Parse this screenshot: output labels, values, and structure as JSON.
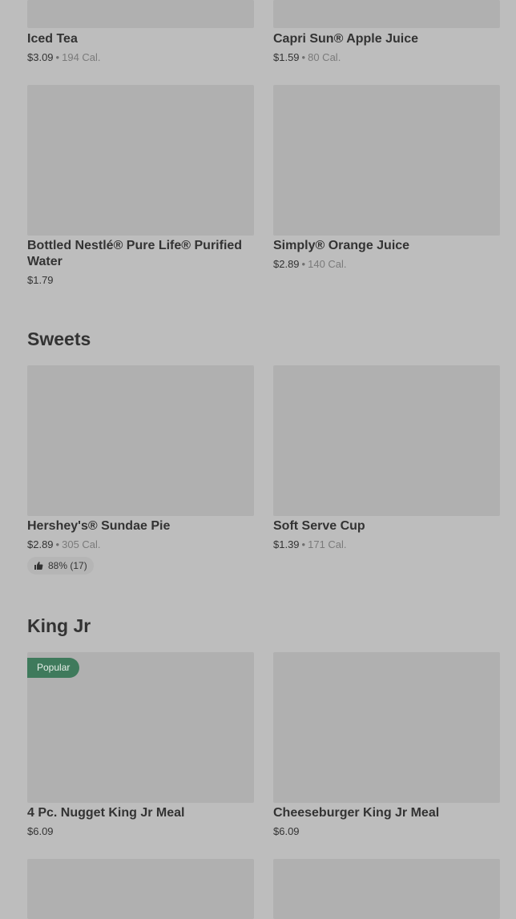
{
  "sections": [
    {
      "title": "",
      "items": [
        {
          "name": "Iced Tea",
          "price": "$3.09",
          "cal": "194 Cal."
        },
        {
          "name": "Capri Sun® Apple Juice",
          "price": "$1.59",
          "cal": "80 Cal."
        },
        {
          "name": "Bottled Nestlé® Pure Life® Purified Water",
          "price": "$1.79",
          "cal": ""
        },
        {
          "name": "Simply® Orange Juice",
          "price": "$2.89",
          "cal": "140 Cal."
        }
      ]
    },
    {
      "title": "Sweets",
      "items": [
        {
          "name": "Hershey's® Sundae Pie",
          "price": "$2.89",
          "cal": "305 Cal.",
          "rating": "88% (17)"
        },
        {
          "name": "Soft Serve Cup",
          "price": "$1.39",
          "cal": "171 Cal."
        }
      ]
    },
    {
      "title": "King Jr",
      "items": [
        {
          "name": "4 Pc. Nugget King Jr Meal",
          "price": "$6.09",
          "badge": "Popular"
        },
        {
          "name": "Cheeseburger King Jr Meal",
          "price": "$6.09"
        }
      ]
    }
  ],
  "separator": "•",
  "icons": {
    "rating": "thumbs-up-icon"
  },
  "colors": {
    "badge": "#3f7a5c",
    "background": "#bdbdbd",
    "image_placeholder": "#b0b0b0"
  }
}
